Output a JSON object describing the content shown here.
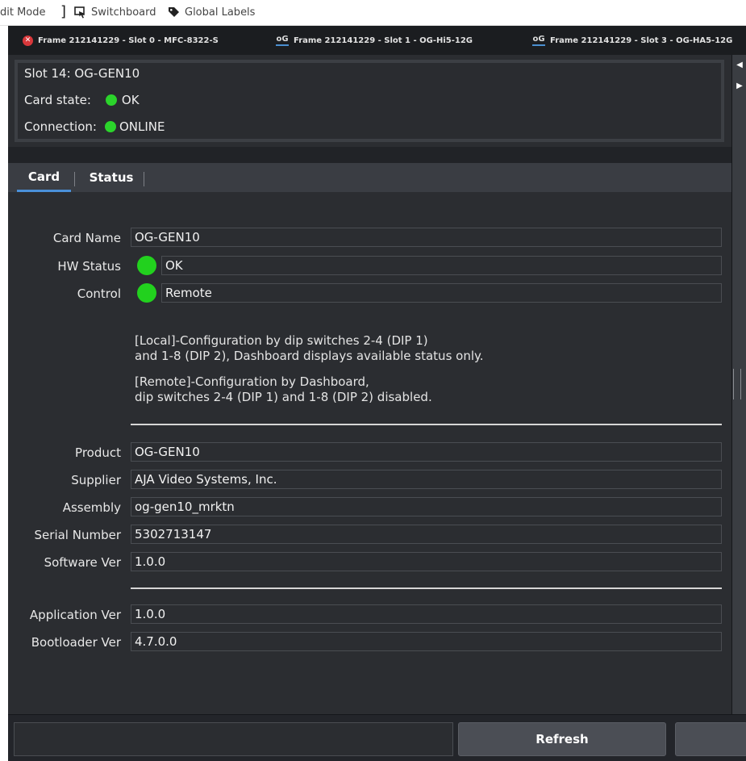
{
  "toolbar": {
    "edit_mode_label": "dit Mode",
    "switchboard_label": "Switchboard",
    "global_labels_label": "Global Labels"
  },
  "frame_tabs": [
    {
      "label": "Frame 212141229 - Slot 0 - MFC-8322-S"
    },
    {
      "label": "Frame 212141229 - Slot 1 - OG-Hi5-12G"
    },
    {
      "label": "Frame 212141229 - Slot 3 - OG-HA5-12G"
    }
  ],
  "og_mark": "oG",
  "slot_info": {
    "slot_title": "Slot 14: OG-GEN10",
    "card_state_label": "Card state:",
    "card_state_value": "OK",
    "connection_label": "Connection:",
    "connection_value": "ONLINE"
  },
  "sub_tabs": [
    {
      "label": "Card",
      "active": true
    },
    {
      "label": "Status",
      "active": false
    }
  ],
  "card": {
    "card_name_label": "Card Name",
    "card_name_value": "OG-GEN10",
    "hw_status_label": "HW Status",
    "hw_status_value": "OK",
    "control_label": "Control",
    "control_value": "Remote",
    "note_local_1": "[Local]-Configuration by dip switches 2-4 (DIP 1)",
    "note_local_2": "and 1-8 (DIP 2), Dashboard displays available status only.",
    "note_remote_1": "[Remote]-Configuration by Dashboard,",
    "note_remote_2": "dip switches 2-4 (DIP 1) and 1-8 (DIP 2) disabled.",
    "product_label": "Product",
    "product_value": "OG-GEN10",
    "supplier_label": "Supplier",
    "supplier_value": "AJA Video Systems, Inc.",
    "assembly_label": "Assembly",
    "assembly_value": "og-gen10_mrktn",
    "serial_label": "Serial Number",
    "serial_value": "5302713147",
    "software_label": "Software Ver",
    "software_value": "1.0.0",
    "application_label": "Application Ver",
    "application_value": "1.0.0",
    "bootloader_label": "Bootloader Ver",
    "bootloader_value": "4.7.0.0"
  },
  "footer": {
    "refresh_label": "Refresh"
  },
  "colors": {
    "status_green": "#22d11e",
    "accent_blue": "#4a90d9",
    "close_red": "#d8383b"
  }
}
